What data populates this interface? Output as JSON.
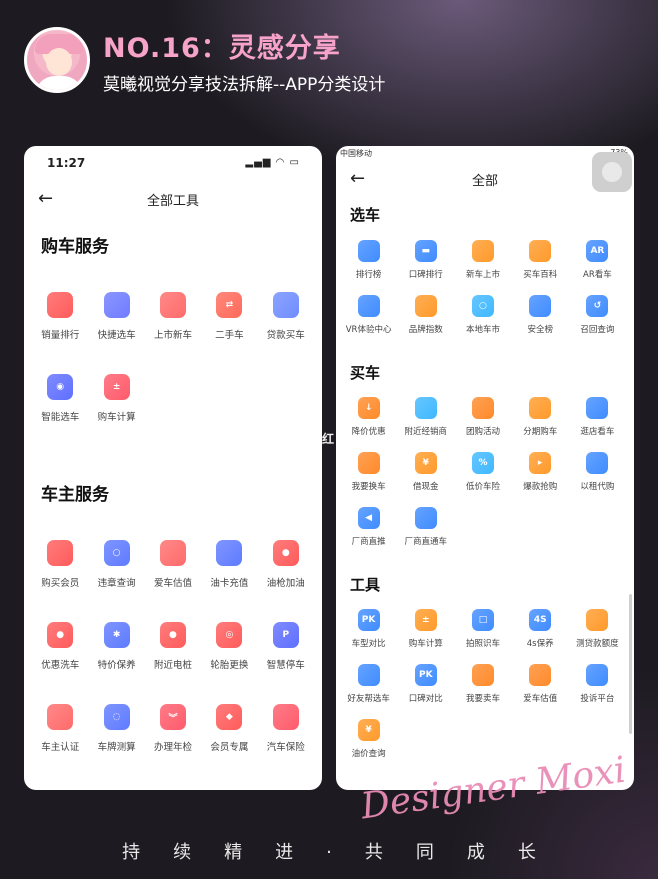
{
  "header": {
    "title": "NO.16：灵感分享",
    "subtitle": "莫曦视觉分享技法拆解--APP分类设计"
  },
  "left_phone": {
    "time": "11:27",
    "status_icons": "▂▄▆ ◠ ▭",
    "back": "←",
    "title": "全部工具",
    "sections": [
      {
        "title": "购车服务",
        "items": [
          {
            "label": "销量排行",
            "icon": "bar-chart-icon",
            "color": "#ff5b5b"
          },
          {
            "label": "快捷选车",
            "icon": "quick-select-icon",
            "color": "#6f7cff"
          },
          {
            "label": "上市新车",
            "icon": "badge-icon",
            "color": "#ff6b6b"
          },
          {
            "label": "二手车",
            "icon": "swap-icon",
            "color": "#ff6a5a"
          },
          {
            "label": "贷款买车",
            "icon": "card-icon",
            "color": "#6f8dff"
          },
          {
            "label": "智能选车",
            "icon": "eye-icon",
            "color": "#5f6fff"
          },
          {
            "label": "购车计算",
            "icon": "calc-icon",
            "color": "#ff5b6b"
          }
        ]
      },
      {
        "title": "车主服务",
        "items": [
          {
            "label": "购买会员",
            "icon": "member-icon",
            "color": "#ff5b5b"
          },
          {
            "label": "违章查询",
            "icon": "search-icon",
            "color": "#5f7bff"
          },
          {
            "label": "爱车估值",
            "icon": "sliders-icon",
            "color": "#ff6b6b"
          },
          {
            "label": "油卡充值",
            "icon": "fuel-card-icon",
            "color": "#5f7bff"
          },
          {
            "label": "油枪加油",
            "icon": "fuel-drop-icon",
            "color": "#ff5b5b"
          },
          {
            "label": "优惠洗车",
            "icon": "water-drop-icon",
            "color": "#ff5b5b"
          },
          {
            "label": "特价保养",
            "icon": "gear-icon",
            "color": "#5f7bff"
          },
          {
            "label": "附近电桩",
            "icon": "location-pin-icon",
            "color": "#ff5b5b"
          },
          {
            "label": "轮胎更换",
            "icon": "tire-icon",
            "color": "#ff5b5b"
          },
          {
            "label": "智慧停车",
            "icon": "parking-icon",
            "color": "#5f6fff"
          },
          {
            "label": "车主认证",
            "icon": "user-verify-icon",
            "color": "#ff6b6b"
          },
          {
            "label": "车牌测算",
            "icon": "ring-icon",
            "color": "#5f7bff"
          },
          {
            "label": "办理年检",
            "icon": "chevron-down-icon",
            "color": "#ff5b6b"
          },
          {
            "label": "会员专属",
            "icon": "diamond-icon",
            "color": "#ff5b5b"
          },
          {
            "label": "汽车保险",
            "icon": "shield-link-icon",
            "color": "#ff5b6b"
          }
        ]
      }
    ]
  },
  "right_phone": {
    "carrier": "中国移动",
    "status_right": "73%",
    "back": "←",
    "title": "全部",
    "sections": [
      {
        "title": "选车",
        "items": [
          {
            "label": "排行榜",
            "icon": "rank-icon",
            "color": "#3f8cff"
          },
          {
            "label": "口碑排行",
            "icon": "chat-icon",
            "color": "#3f8cff"
          },
          {
            "label": "新车上市",
            "icon": "car-icon",
            "color": "#ff9a2a"
          },
          {
            "label": "买车百科",
            "icon": "book-icon",
            "color": "#ff9a2a"
          },
          {
            "label": "AR看车",
            "icon": "ar-icon",
            "color": "#3f8cff"
          },
          {
            "label": "VR体验中心",
            "icon": "vr-icon",
            "color": "#3f8cff"
          },
          {
            "label": "品牌指数",
            "icon": "chart-icon",
            "color": "#ff9a2a"
          },
          {
            "label": "本地车市",
            "icon": "globe-icon",
            "color": "#3fb8ff"
          },
          {
            "label": "安全榜",
            "icon": "safety-car-icon",
            "color": "#3f8cff"
          },
          {
            "label": "召回查询",
            "icon": "recall-icon",
            "color": "#3f8cff"
          }
        ]
      },
      {
        "title": "买车",
        "items": [
          {
            "label": "降价优惠",
            "icon": "price-down-icon",
            "color": "#ff8a2a"
          },
          {
            "label": "附近经销商",
            "icon": "map-icon",
            "color": "#3fb8ff"
          },
          {
            "label": "团购活动",
            "icon": "bag-icon",
            "color": "#ff8a2a"
          },
          {
            "label": "分期购车",
            "icon": "card-icon",
            "color": "#ff9a2a"
          },
          {
            "label": "逛店看车",
            "icon": "store-icon",
            "color": "#3f8cff"
          },
          {
            "label": "我要换车",
            "icon": "swap-car-icon",
            "color": "#ff8a2a"
          },
          {
            "label": "借现金",
            "icon": "cash-icon",
            "color": "#ff9a2a"
          },
          {
            "label": "低价车险",
            "icon": "discount-icon",
            "color": "#3fb8ff"
          },
          {
            "label": "爆款抢购",
            "icon": "tag-icon",
            "color": "#ff9a2a"
          },
          {
            "label": "以租代购",
            "icon": "rent-car-icon",
            "color": "#3f8cff"
          },
          {
            "label": "厂商直推",
            "icon": "megaphone-icon",
            "color": "#3f8cff"
          },
          {
            "label": "厂商直通车",
            "icon": "shop-icon",
            "color": "#3f8cff"
          }
        ]
      },
      {
        "title": "工具",
        "items": [
          {
            "label": "车型对比",
            "icon": "pk-icon",
            "color": "#3f8cff"
          },
          {
            "label": "购车计算",
            "icon": "calc-icon",
            "color": "#ff9a2a"
          },
          {
            "label": "拍照识车",
            "icon": "camera-icon",
            "color": "#3f8cff"
          },
          {
            "label": "4s保养",
            "icon": "4s-icon",
            "color": "#3f8cff"
          },
          {
            "label": "测贷款额度",
            "icon": "loan-chart-icon",
            "color": "#ff9a2a"
          },
          {
            "label": "好友帮选车",
            "icon": "friend-icon",
            "color": "#3f8cff"
          },
          {
            "label": "口碑对比",
            "icon": "pk-icon",
            "color": "#3f8cff"
          },
          {
            "label": "我要卖车",
            "icon": "sell-icon",
            "color": "#ff8a2a"
          },
          {
            "label": "爱车估值",
            "icon": "value-icon",
            "color": "#ff8a2a"
          },
          {
            "label": "投诉平台",
            "icon": "complaint-icon",
            "color": "#3f8cff"
          },
          {
            "label": "油价查询",
            "icon": "yuan-icon",
            "color": "#ff9a2a"
          }
        ]
      }
    ]
  },
  "stray_text": "红",
  "signature": "Designer Moxi",
  "tagline": "持续精进·共同成长"
}
